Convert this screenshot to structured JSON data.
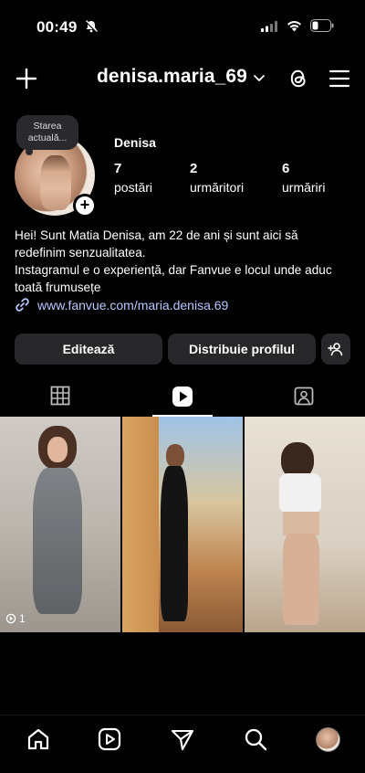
{
  "status_bar": {
    "time": "00:49"
  },
  "header": {
    "username": "denisa.maria_69"
  },
  "profile": {
    "note": "Starea actuală...",
    "display_name": "Denisa",
    "stats": [
      {
        "value": "7",
        "label": "postări"
      },
      {
        "value": "2",
        "label": "urmăritori"
      },
      {
        "value": "6",
        "label": "urmăriri"
      }
    ],
    "bio_lines": [
      "Hei! Sunt Matia Denisa, am 22 de ani și sunt aici să redefinim senzualitatea.",
      "Instagramul e o experiență, dar Fanvue e locul unde aduc toată frumusețe"
    ],
    "link": "www.fanvue.com/maria.denisa.69"
  },
  "actions": {
    "edit": "Editează",
    "share": "Distribuie profilul"
  },
  "tabs": [
    {
      "name": "posts-grid",
      "icon": "grid-icon",
      "active": false
    },
    {
      "name": "reels",
      "icon": "reels-icon",
      "active": true
    },
    {
      "name": "tagged",
      "icon": "tagged-icon",
      "active": false
    }
  ],
  "posts": [
    {
      "badge": "1",
      "icon": "views-icon"
    },
    {
      "badge": ""
    },
    {
      "badge": ""
    }
  ],
  "nav": [
    "home-icon",
    "reels-icon",
    "send-icon",
    "search-icon",
    "profile-avatar"
  ],
  "colors": {
    "background": "#000000",
    "button": "#27272a",
    "link": "#b7c7ff",
    "accent": "#ffffff"
  }
}
